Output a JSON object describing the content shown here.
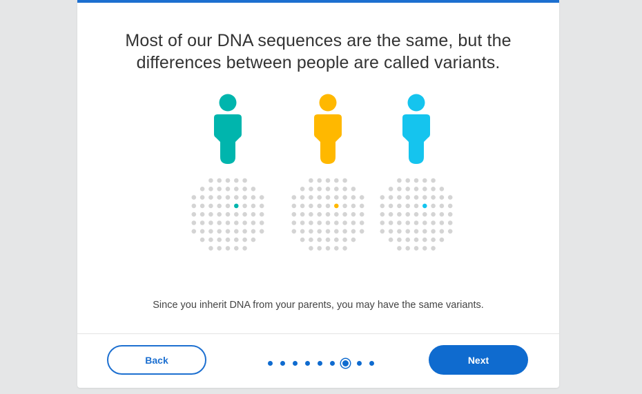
{
  "headline": "Most of our DNA sequences are the same, but the differences between people are called variants.",
  "headline_line1": "Most of our DNA sequences are the same, but the",
  "headline_line2": "differences between people are called variants.",
  "people": [
    {
      "name": "person-1",
      "color": "#00b5ad",
      "variant_row": 4,
      "variant_col": 6
    },
    {
      "name": "person-2",
      "color": "#ffb800",
      "variant_row": 4,
      "variant_col": 6
    },
    {
      "name": "person-3",
      "color": "#15c4ee",
      "variant_row": 4,
      "variant_col": 6
    }
  ],
  "dot_grid_color": "#d4d4d4",
  "caption": "Since you inherit DNA from your parents, you may have the same variants.",
  "footer": {
    "back_label": "Back",
    "next_label": "Next",
    "pagination": {
      "total": 9,
      "current": 7
    }
  },
  "colors": {
    "accent": "#1c6fd0",
    "primary_button": "#0f6bcf"
  }
}
